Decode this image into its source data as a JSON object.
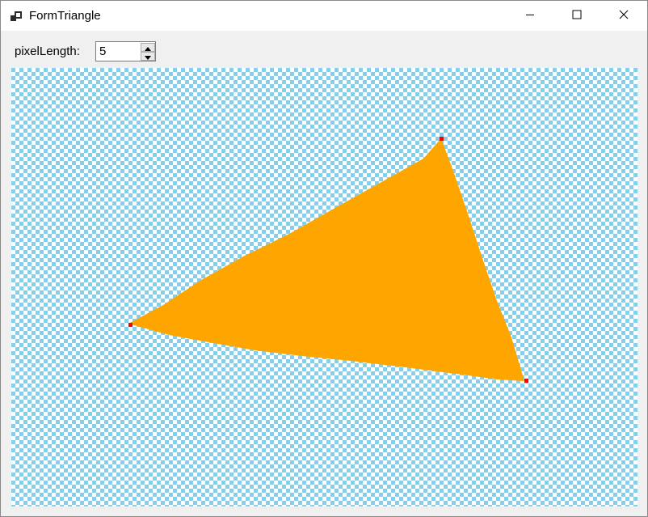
{
  "window": {
    "title": "FormTriangle",
    "app_icon": "form-app-icon",
    "controls": {
      "minimize_icon": "minimize-icon",
      "maximize_icon": "maximize-icon",
      "close_icon": "close-icon"
    }
  },
  "toolbar": {
    "pixel_length_label": "pixelLength:",
    "pixel_length_value": "5",
    "up_icon": "arrow-up-icon",
    "down_icon": "arrow-down-icon"
  },
  "canvas": {
    "background_checker_colors": [
      "#87ceeb",
      "#ffffff"
    ],
    "fill_color": "#ffa500",
    "vertex_color": "#ff0000"
  }
}
